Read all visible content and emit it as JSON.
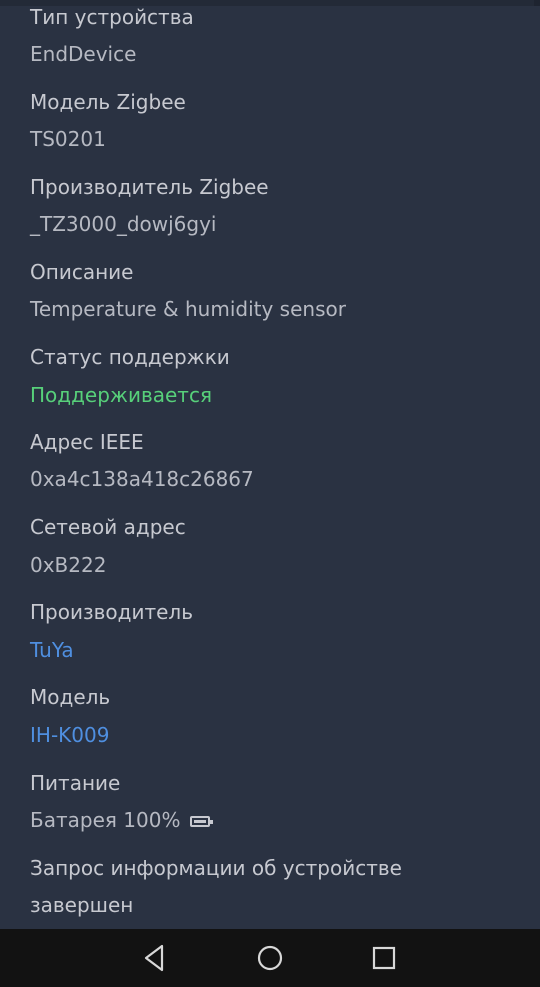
{
  "fields": [
    {
      "label": "Тип устройства",
      "value": "EndDevice"
    },
    {
      "label": "Модель Zigbee",
      "value": "TS0201"
    },
    {
      "label": "Производитель Zigbee",
      "value": "_TZ3000_dowj6gyi"
    },
    {
      "label": "Описание",
      "value": "Temperature & humidity sensor"
    },
    {
      "label": "Статус поддержки",
      "value": "Поддерживается"
    },
    {
      "label": "Адрес IEEE",
      "value": "0xa4c138a418c26867"
    },
    {
      "label": "Сетевой адрес",
      "value": "0xB222"
    },
    {
      "label": "Производитель",
      "value": "TuYa"
    },
    {
      "label": "Модель",
      "value": "IH-K009"
    },
    {
      "label": "Питание",
      "value": "Батарея 100%"
    },
    {
      "label": "Запрос информации об устройстве",
      "value": "завершен"
    }
  ],
  "icons": {
    "power": "battery-full-icon",
    "nav_back": "back-triangle-icon",
    "nav_home": "home-circle-icon",
    "nav_recents": "recents-square-icon"
  },
  "colors": {
    "background": "#2a3242",
    "label": "#c7c9d0",
    "value": "#b6b9c2",
    "supported": "#57d07a",
    "link": "#4f8fe0",
    "navbar": "#121212"
  }
}
